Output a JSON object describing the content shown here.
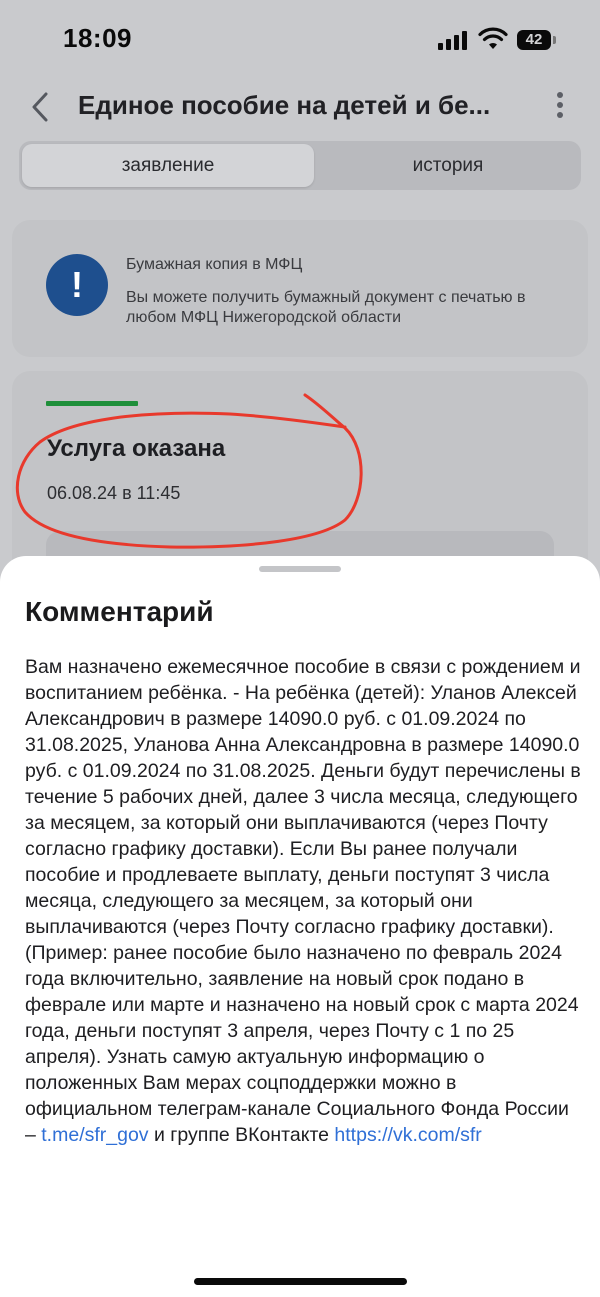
{
  "status_bar": {
    "time": "18:09",
    "battery_level": "42",
    "icons": [
      "signal-icon",
      "wifi-icon",
      "battery-icon"
    ]
  },
  "header": {
    "title": "Единое пособие на детей и бе...",
    "back_icon": "chevron-left-icon",
    "menu_icon": "more-vertical-icon"
  },
  "tabs": [
    {
      "label": "заявление",
      "active": true
    },
    {
      "label": "история",
      "active": false
    }
  ],
  "info_card": {
    "icon": "exclamation-icon",
    "title": "Бумажная копия в МФЦ",
    "text": "Вы можете получить бумажный документ с печатью в любом МФЦ Нижегородской области"
  },
  "status_card": {
    "status": "Услуга оказана",
    "datetime": "06.08.24 в 11:45",
    "status_color": "#1f8f3a"
  },
  "comment_sheet": {
    "title": "Комментарий",
    "text_before": "Вам назначено ежемесячное пособие в связи с рождением и воспитанием ребёнка. - На ребёнка (детей): Уланов Алексей Александрович в размере 14090.0 руб. с 01.09.2024 по 31.08.2025, Уланова Анна Александровна в размере 14090.0 руб. с 01.09.2024 по 31.08.2025. Деньги будут перечислены в течение 5 рабочих дней, далее 3 числа месяца, следующего за месяцем, за который они выплачиваются (через Почту согласно графику доставки). Если Вы ранее получали пособие и продлеваете выплату, деньги поступят 3 числа месяца, следующего за месяцем, за который они выплачиваются (через Почту согласно графику доставки). (Пример: ранее пособие было назначено по февраль 2024 года включительно, заявление на новый срок подано в феврале или марте и назначено на новый срок с марта 2024 года, деньги поступят 3 апреля, через Почту с 1 по 25 апреля). Узнать самую актуальную информацию о положенных Вам мерах соцподдержки можно в официальном телеграм-канале Социального Фонда России – ",
    "link_telegram": "t.me/sfr_gov",
    "text_middle": " и группе ВКонтакте ",
    "link_vk": "https://vk.com/sfr",
    "link_color": "#2f6fd6"
  },
  "colors": {
    "overlay_background": "#c9cacd",
    "annotation_stroke": "#e8392c"
  }
}
